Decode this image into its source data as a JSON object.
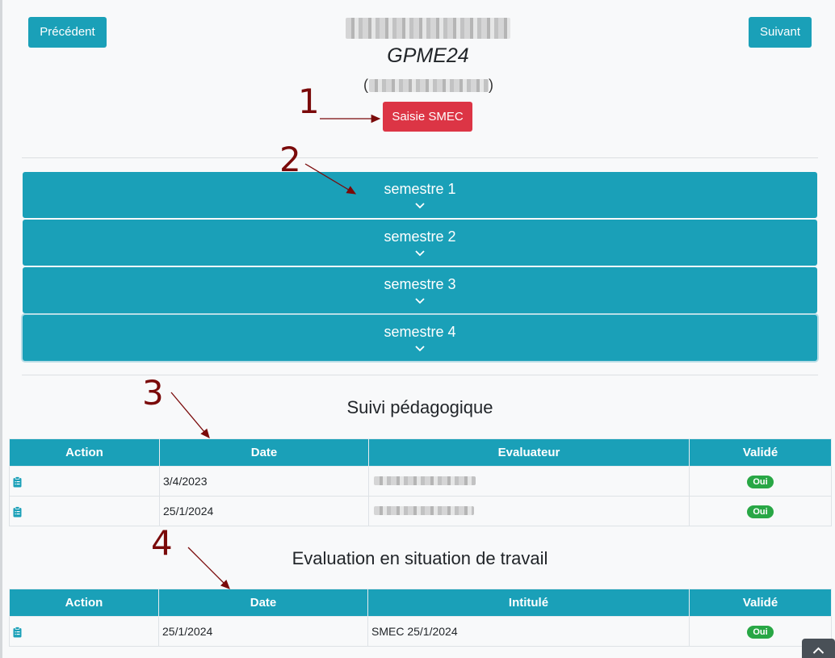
{
  "nav": {
    "prev_label": "Précédent",
    "next_label": "Suivant"
  },
  "header": {
    "code": "GPME24",
    "paren_open": "(",
    "paren_close": ")"
  },
  "smec_button_label": "Saisie SMEC",
  "semesters": [
    {
      "label": "semestre 1"
    },
    {
      "label": "semestre 2"
    },
    {
      "label": "semestre 3"
    },
    {
      "label": "semestre 4"
    }
  ],
  "suivi": {
    "title": "Suivi pédagogique",
    "headers": [
      "Action",
      "Date",
      "Evaluateur",
      "Validé"
    ],
    "rows": [
      {
        "icon": "clipboard-list-icon",
        "date": "3/4/2023",
        "validated": "Oui"
      },
      {
        "icon": "clipboard-list-icon",
        "date": "25/1/2024",
        "validated": "Oui"
      }
    ]
  },
  "evaluation": {
    "title": "Evaluation en situation de travail",
    "headers": [
      "Action",
      "Date",
      "Intitulé",
      "Validé"
    ],
    "rows": [
      {
        "icon": "clipboard-list-icon",
        "date": "25/1/2024",
        "title": "SMEC 25/1/2024",
        "validated": "Oui"
      }
    ]
  },
  "annotations": [
    "1",
    "2",
    "3",
    "4"
  ],
  "colors": {
    "primary": "#1aa0b8",
    "danger": "#dc3545",
    "success": "#28a745",
    "annotation": "#7a0a0a"
  }
}
